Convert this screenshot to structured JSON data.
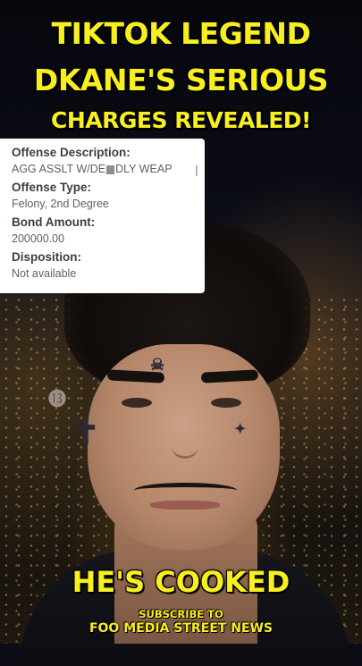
{
  "headline": {
    "line1": "TIKTOK LEGEND",
    "line2": "DKANE'S SERIOUS",
    "line3": "CHARGES REVEALED!"
  },
  "record": {
    "offense_description_label": "Offense Description:",
    "offense_description_value_start": "AGG ASSLT W/DE",
    "offense_description_value_end": "DLY WEAP",
    "offense_type_label": "Offense Type:",
    "offense_type_value": "Felony, 2nd Degree",
    "bond_amount_label": "Bond Amount:",
    "bond_amount_value": "200000.00",
    "disposition_label": "Disposition:",
    "disposition_value": "Not available"
  },
  "caption": "HE'S COOKED",
  "subscribe": {
    "line1": "SUBSCRIBE TO",
    "line2": "FOO MEDIA STREET NEWS"
  },
  "colors": {
    "headline_yellow": "#f7ef1f",
    "panel_bg": "#ffffff"
  }
}
